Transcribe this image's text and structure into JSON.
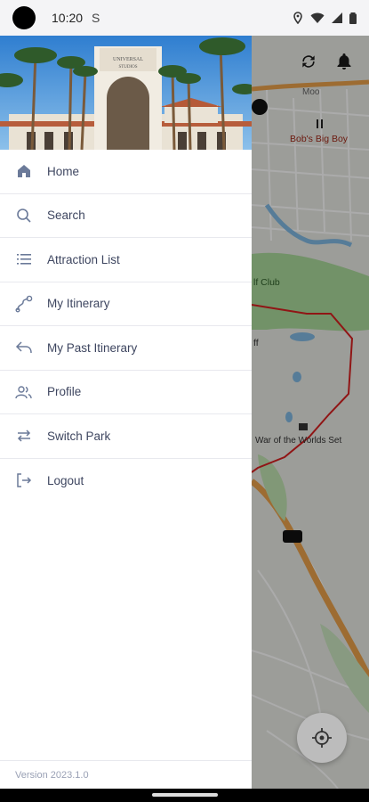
{
  "status": {
    "time": "10:20",
    "carrier_icon": "S"
  },
  "header": {
    "image_alt": "park-entrance-photo"
  },
  "menu": [
    {
      "label": "Home",
      "icon": "home-icon"
    },
    {
      "label": "Search",
      "icon": "search-icon"
    },
    {
      "label": "Attraction List",
      "icon": "list-icon"
    },
    {
      "label": "My Itinerary",
      "icon": "route-icon"
    },
    {
      "label": "My Past Itinerary",
      "icon": "history-icon"
    },
    {
      "label": "Profile",
      "icon": "profile-icon"
    },
    {
      "label": "Switch Park",
      "icon": "switch-icon"
    },
    {
      "label": "Logout",
      "icon": "logout-icon"
    }
  ],
  "version": "Version 2023.1.0",
  "map": {
    "labels": {
      "restaurant": "Bob's Big Boy",
      "golf": "lf Club",
      "set": "War of the Worlds Set",
      "road": "Moo",
      "ff": "ff"
    }
  },
  "colors": {
    "accent": "#3e4660",
    "home_icon": "#6b7a99",
    "boundary": "#d42020"
  }
}
